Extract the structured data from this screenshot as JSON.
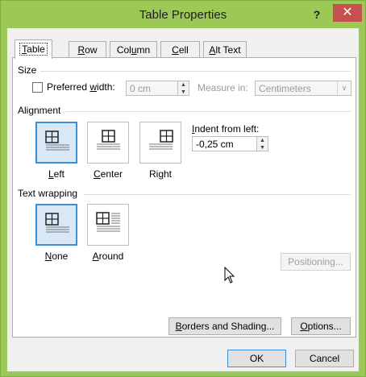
{
  "window": {
    "title": "Table Properties",
    "help": "?",
    "close": "✕"
  },
  "tabs": [
    {
      "label": "Table",
      "key": "T",
      "rest": "able",
      "active": true
    },
    {
      "label": "Row",
      "key": "R",
      "rest": "ow"
    },
    {
      "label": "Column",
      "pre": "Col",
      "key": "u",
      "rest": "mn"
    },
    {
      "label": "Cell",
      "key": "C",
      "rest": "ell"
    },
    {
      "label": "Alt Text",
      "pre": "",
      "key": "A",
      "rest": "lt Text"
    }
  ],
  "size": {
    "heading": "Size",
    "preferred_pre": "Preferred ",
    "preferred_key": "w",
    "preferred_rest": "idth:",
    "preferred_checked": false,
    "width_value": "0 cm",
    "measure_label": "Measure in:",
    "measure_value": "Centimeters"
  },
  "alignment": {
    "heading": "Alignment",
    "options": [
      {
        "pre": "",
        "key": "L",
        "rest": "eft",
        "selected": true
      },
      {
        "pre": "",
        "key": "C",
        "rest": "enter",
        "selected": false
      },
      {
        "pre": "Ri",
        "key": "g",
        "rest": "ht",
        "selected": false
      }
    ],
    "indent_label_key": "I",
    "indent_label_rest": "ndent from left:",
    "indent_value": "-0,25 cm"
  },
  "wrapping": {
    "heading": "Text wrapping",
    "options": [
      {
        "pre": "",
        "key": "N",
        "rest": "one",
        "selected": true
      },
      {
        "pre": "",
        "key": "A",
        "rest": "round",
        "selected": false
      }
    ],
    "positioning": "Positioning..."
  },
  "buttons": {
    "borders_key": "B",
    "borders_rest": "orders and Shading...",
    "options_key": "O",
    "options_rest": "ptions...",
    "ok": "OK",
    "cancel": "Cancel"
  },
  "colors": {
    "titlebar": "#9cc955",
    "close": "#c74f4f",
    "selection": "#3c8fd6"
  }
}
